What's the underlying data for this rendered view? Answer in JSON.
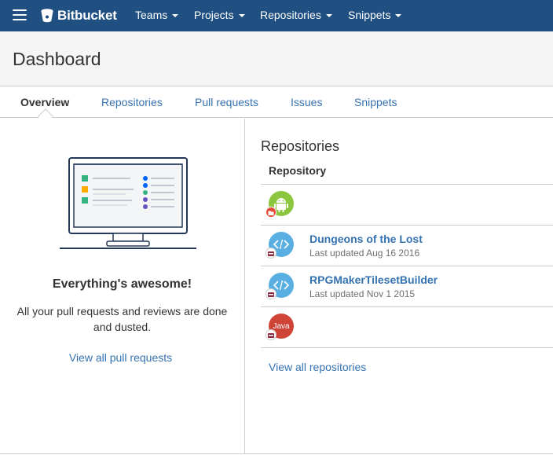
{
  "nav": {
    "logo_text": "Bitbucket",
    "items": [
      "Teams",
      "Projects",
      "Repositories",
      "Snippets"
    ]
  },
  "header": {
    "title": "Dashboard"
  },
  "tabs": [
    "Overview",
    "Repositories",
    "Pull requests",
    "Issues",
    "Snippets"
  ],
  "left": {
    "title": "Everything's awesome!",
    "text": "All your pull requests and reviews are done and dusted.",
    "link": "View all pull requests"
  },
  "right": {
    "heading": "Repositories",
    "column_header": "Repository",
    "repos": [
      {
        "name": "",
        "updated": "",
        "avatar": "android-icon",
        "color": "#8cc63e"
      },
      {
        "name": "Dungeons of the Lost",
        "updated": "Last updated Aug 16 2016",
        "avatar": "code-icon",
        "color": "#59afe1"
      },
      {
        "name": "RPGMakerTilesetBuilder",
        "updated": "Last updated Nov 1 2015",
        "avatar": "code-icon",
        "color": "#59afe1"
      },
      {
        "name": "",
        "updated": "",
        "avatar": "java-icon",
        "color": "#d04437",
        "label": "Java"
      }
    ],
    "link": "View all repositories"
  },
  "colors": {
    "nav_bg": "#205081",
    "link": "#3572b0",
    "header_bg": "#f5f5f5"
  }
}
